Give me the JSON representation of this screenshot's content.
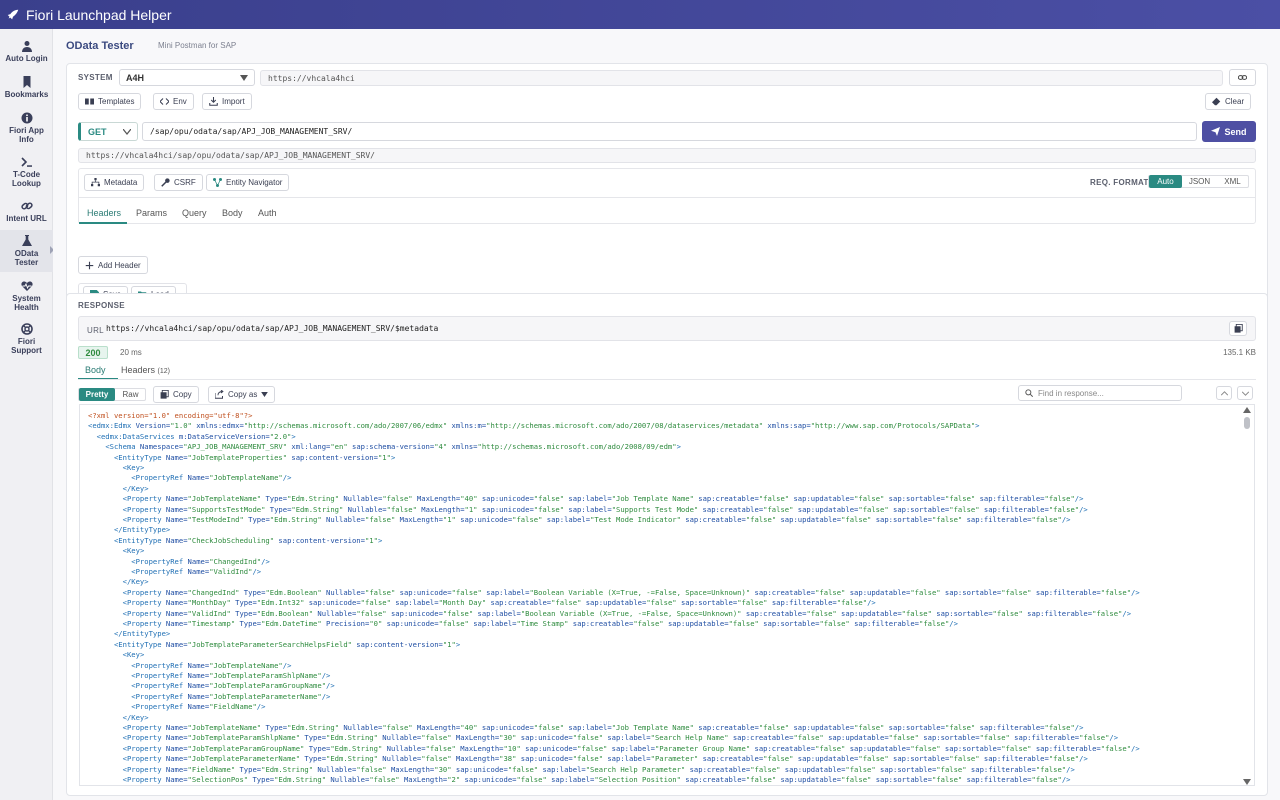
{
  "app": {
    "title": "Fiori Launchpad Helper"
  },
  "sidebar": {
    "items": [
      {
        "label": "Auto Login",
        "icon": "user-icon"
      },
      {
        "label": "Bookmarks",
        "icon": "bookmark-icon"
      },
      {
        "label": "Fiori App Info",
        "icon": "info-icon"
      },
      {
        "label": "T-Code Lookup",
        "icon": "terminal-icon"
      },
      {
        "label": "Intent URL",
        "icon": "link-icon"
      },
      {
        "label": "OData Tester",
        "icon": "flask-icon"
      },
      {
        "label": "System Health",
        "icon": "heart-pulse-icon"
      },
      {
        "label": "Fiori Support",
        "icon": "lifebuoy-icon"
      }
    ]
  },
  "page": {
    "title": "OData Tester",
    "subtitle": "Mini Postman for SAP"
  },
  "request": {
    "system_label": "SYSTEM",
    "system_value": "A4H",
    "system_url": "https://vhcala4hci",
    "templates_label": "Templates",
    "env_label": "Env",
    "import_label": "Import",
    "clear_label": "Clear",
    "method": "GET",
    "path": "/sap/opu/odata/sap/APJ_JOB_MANAGEMENT_SRV/",
    "send_label": "Send",
    "full_url": "https://vhcala4hci/sap/opu/odata/sap/APJ_JOB_MANAGEMENT_SRV/",
    "metadata_label": "Metadata",
    "csrf_label": "CSRF",
    "entity_nav_label": "Entity Navigator",
    "req_format_label": "REQ. FORMAT",
    "formats": [
      "Auto",
      "JSON",
      "XML"
    ],
    "tabs": [
      "Headers",
      "Params",
      "Query",
      "Body",
      "Auth"
    ],
    "add_header_label": "Add Header",
    "save_label": "Save",
    "load_label": "Load"
  },
  "response": {
    "label": "RESPONSE",
    "url_label": "URL",
    "url": "https://vhcala4hci/sap/opu/odata/sap/APJ_JOB_MANAGEMENT_SRV/$metadata",
    "status": "200",
    "time": "20 ms",
    "size": "135.1 KB",
    "tabs": {
      "body": "Body",
      "headers": "Headers",
      "headers_count": "(12)"
    },
    "pretty_label": "Pretty",
    "raw_label": "Raw",
    "copy_label": "Copy",
    "copy_as_label": "Copy as",
    "find_placeholder": "Find in response...",
    "colors": {
      "accent": "#2a8a82",
      "primary": "#4e4fa3",
      "xml_tag": "#1f6fb4",
      "xml_attr": "#1f4ea3",
      "xml_string": "#2e8b3e"
    },
    "lines": [
      "<?xml version=\"1.0\" encoding=\"utf-8\"?>",
      "<edmx:Edmx Version=\"1.0\" xmlns:edmx=\"http://schemas.microsoft.com/ado/2007/06/edmx\" xmlns:m=\"http://schemas.microsoft.com/ado/2007/08/dataservices/metadata\" xmlns:sap=\"http://www.sap.com/Protocols/SAPData\">",
      "  <edmx:DataServices m:DataServiceVersion=\"2.0\">",
      "    <Schema Namespace=\"APJ_JOB_MANAGEMENT_SRV\" xml:lang=\"en\" sap:schema-version=\"4\" xmlns=\"http://schemas.microsoft.com/ado/2008/09/edm\">",
      "      <EntityType Name=\"JobTemplateProperties\" sap:content-version=\"1\">",
      "        <Key>",
      "          <PropertyRef Name=\"JobTemplateName\"/>",
      "        </Key>",
      "        <Property Name=\"JobTemplateName\" Type=\"Edm.String\" Nullable=\"false\" MaxLength=\"40\" sap:unicode=\"false\" sap:label=\"Job Template Name\" sap:creatable=\"false\" sap:updatable=\"false\" sap:sortable=\"false\" sap:filterable=\"false\"/>",
      "        <Property Name=\"SupportsTestMode\" Type=\"Edm.String\" Nullable=\"false\" MaxLength=\"1\" sap:unicode=\"false\" sap:label=\"Supports Test Mode\" sap:creatable=\"false\" sap:updatable=\"false\" sap:sortable=\"false\" sap:filterable=\"false\"/>",
      "        <Property Name=\"TestModeInd\" Type=\"Edm.String\" Nullable=\"false\" MaxLength=\"1\" sap:unicode=\"false\" sap:label=\"Test Mode Indicator\" sap:creatable=\"false\" sap:updatable=\"false\" sap:sortable=\"false\" sap:filterable=\"false\"/>",
      "      </EntityType>",
      "      <EntityType Name=\"CheckJobScheduling\" sap:content-version=\"1\">",
      "        <Key>",
      "          <PropertyRef Name=\"ChangedInd\"/>",
      "          <PropertyRef Name=\"ValidInd\"/>",
      "        </Key>",
      "        <Property Name=\"ChangedInd\" Type=\"Edm.Boolean\" Nullable=\"false\" sap:unicode=\"false\" sap:label=\"Boolean Variable (X=True, -=False, Space=Unknown)\" sap:creatable=\"false\" sap:updatable=\"false\" sap:sortable=\"false\" sap:filterable=\"false\"/>",
      "        <Property Name=\"MonthDay\" Type=\"Edm.Int32\" sap:unicode=\"false\" sap:label=\"Month Day\" sap:creatable=\"false\" sap:updatable=\"false\" sap:sortable=\"false\" sap:filterable=\"false\"/>",
      "        <Property Name=\"ValidInd\" Type=\"Edm.Boolean\" Nullable=\"false\" sap:unicode=\"false\" sap:label=\"Boolean Variable (X=True, -=False, Space=Unknown)\" sap:creatable=\"false\" sap:updatable=\"false\" sap:sortable=\"false\" sap:filterable=\"false\"/>",
      "        <Property Name=\"Timestamp\" Type=\"Edm.DateTime\" Precision=\"0\" sap:unicode=\"false\" sap:label=\"Time Stamp\" sap:creatable=\"false\" sap:updatable=\"false\" sap:sortable=\"false\" sap:filterable=\"false\"/>",
      "      </EntityType>",
      "      <EntityType Name=\"JobTemplateParameterSearchHelpsField\" sap:content-version=\"1\">",
      "        <Key>",
      "          <PropertyRef Name=\"JobTemplateName\"/>",
      "          <PropertyRef Name=\"JobTemplateParamShlpName\"/>",
      "          <PropertyRef Name=\"JobTemplateParamGroupName\"/>",
      "          <PropertyRef Name=\"JobTemplateParameterName\"/>",
      "          <PropertyRef Name=\"FieldName\"/>",
      "        </Key>",
      "        <Property Name=\"JobTemplateName\" Type=\"Edm.String\" Nullable=\"false\" MaxLength=\"40\" sap:unicode=\"false\" sap:label=\"Job Template Name\" sap:creatable=\"false\" sap:updatable=\"false\" sap:sortable=\"false\" sap:filterable=\"false\"/>",
      "        <Property Name=\"JobTemplateParamShlpName\" Type=\"Edm.String\" Nullable=\"false\" MaxLength=\"30\" sap:unicode=\"false\" sap:label=\"Search Help Name\" sap:creatable=\"false\" sap:updatable=\"false\" sap:sortable=\"false\" sap:filterable=\"false\"/>",
      "        <Property Name=\"JobTemplateParamGroupName\" Type=\"Edm.String\" Nullable=\"false\" MaxLength=\"10\" sap:unicode=\"false\" sap:label=\"Parameter Group Name\" sap:creatable=\"false\" sap:updatable=\"false\" sap:sortable=\"false\" sap:filterable=\"false\"/>",
      "        <Property Name=\"JobTemplateParameterName\" Type=\"Edm.String\" Nullable=\"false\" MaxLength=\"38\" sap:unicode=\"false\" sap:label=\"Parameter\" sap:creatable=\"false\" sap:updatable=\"false\" sap:sortable=\"false\" sap:filterable=\"false\"/>",
      "        <Property Name=\"FieldName\" Type=\"Edm.String\" Nullable=\"false\" MaxLength=\"30\" sap:unicode=\"false\" sap:label=\"Search Help Parameter\" sap:creatable=\"false\" sap:updatable=\"false\" sap:sortable=\"false\" sap:filterable=\"false\"/>",
      "        <Property Name=\"SelectionPos\" Type=\"Edm.String\" Nullable=\"false\" MaxLength=\"2\" sap:unicode=\"false\" sap:label=\"Selection Position\" sap:creatable=\"false\" sap:updatable=\"false\" sap:sortable=\"false\" sap:filterable=\"false\"/>"
    ]
  }
}
